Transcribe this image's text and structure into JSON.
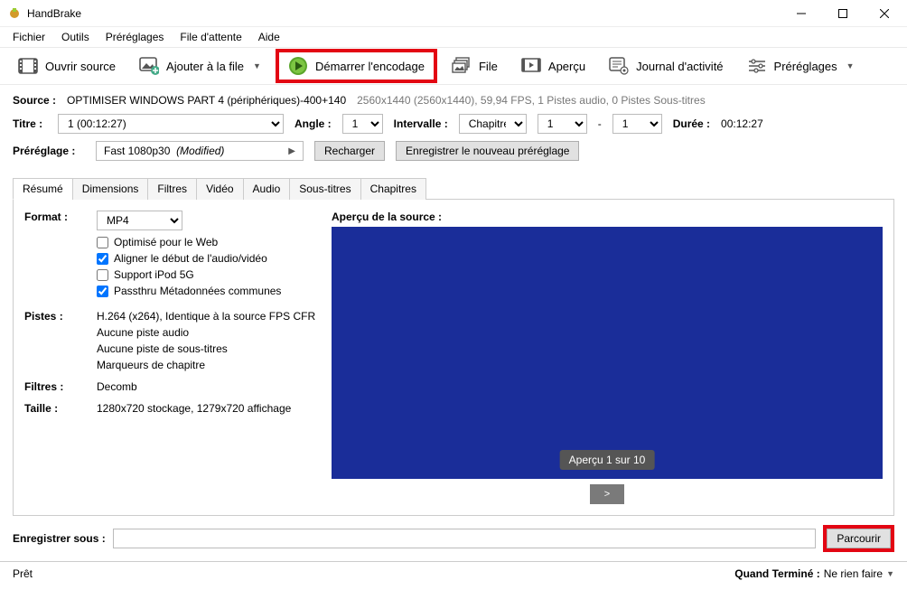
{
  "window": {
    "title": "HandBrake"
  },
  "menubar": [
    "Fichier",
    "Outils",
    "Préréglages",
    "File d'attente",
    "Aide"
  ],
  "toolbar": {
    "open_source": "Ouvrir source",
    "add_queue": "Ajouter à la file",
    "start_encode": "Démarrer l'encodage",
    "queue": "File",
    "preview": "Aperçu",
    "activity_log": "Journal d'activité",
    "presets": "Préréglages"
  },
  "source": {
    "label": "Source :",
    "name": "OPTIMISER WINDOWS PART 4 (périphériques)-400+140",
    "info": "2560x1440 (2560x1440), 59,94 FPS, 1 Pistes audio, 0 Pistes Sous-titres"
  },
  "title_row": {
    "title_label": "Titre :",
    "title_value": "1  (00:12:27)",
    "angle_label": "Angle :",
    "angle_value": "1",
    "interval_label": "Intervalle :",
    "interval_type": "Chapitres",
    "from": "1",
    "to": "1",
    "duration_label": "Durée :",
    "duration_value": "00:12:27"
  },
  "preset": {
    "label": "Préréglage :",
    "value": "Fast 1080p30",
    "modified": "(Modified)",
    "reload": "Recharger",
    "save_new": "Enregistrer le nouveau préréglage"
  },
  "tabs": [
    "Résumé",
    "Dimensions",
    "Filtres",
    "Vidéo",
    "Audio",
    "Sous-titres",
    "Chapitres"
  ],
  "summary": {
    "format_label": "Format :",
    "format_value": "MP4",
    "checks": {
      "web_opt": {
        "label": "Optimisé pour le Web",
        "checked": false
      },
      "av_align": {
        "label": "Aligner le début de l'audio/vidéo",
        "checked": true
      },
      "ipod": {
        "label": "Support iPod 5G",
        "checked": false
      },
      "meta": {
        "label": "Passthru Métadonnées communes",
        "checked": true
      }
    },
    "tracks_label": "Pistes :",
    "tracks": [
      "H.264 (x264), Identique à la source FPS CFR",
      "Aucune piste audio",
      "Aucune piste de sous-titres",
      "Marqueurs de chapitre"
    ],
    "filters_label": "Filtres :",
    "filters_value": "Decomb",
    "size_label": "Taille :",
    "size_value": "1280x720 stockage, 1279x720 affichage",
    "preview_label": "Aperçu de la source :",
    "preview_badge": "Aperçu 1 sur 10"
  },
  "save": {
    "label": "Enregistrer sous :",
    "path": "",
    "browse": "Parcourir"
  },
  "status": {
    "ready": "Prêt",
    "when_done_label": "Quand Terminé :",
    "when_done_value": "Ne rien faire"
  }
}
